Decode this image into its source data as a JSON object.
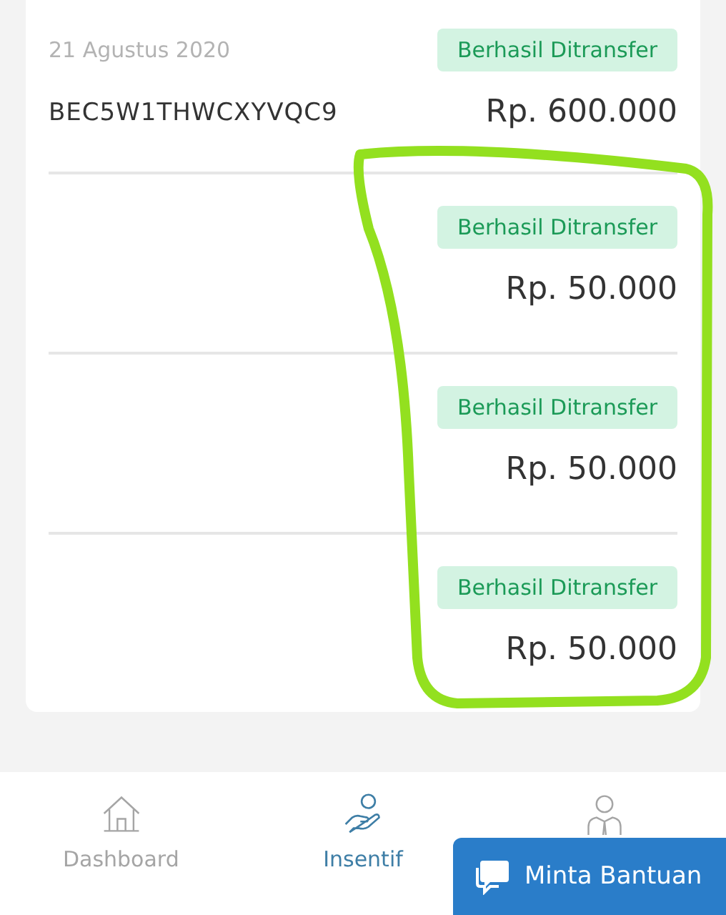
{
  "transactions": [
    {
      "date": "21 Agustus 2020",
      "code": "BEC5W1THWCXYVQC9",
      "status": "Berhasil Ditransfer",
      "amount": "Rp. 600.000"
    },
    {
      "status": "Berhasil Ditransfer",
      "amount": "Rp. 50.000"
    },
    {
      "status": "Berhasil Ditransfer",
      "amount": "Rp. 50.000"
    },
    {
      "status": "Berhasil Ditransfer",
      "amount": "Rp. 50.000"
    }
  ],
  "bottom_nav": [
    {
      "kind": "house",
      "label": "Dashboard",
      "selected": false
    },
    {
      "kind": "hand",
      "label": "Insentif",
      "selected": true
    },
    {
      "kind": "person",
      "selected": false
    }
  ],
  "help_button": {
    "label": "Minta Bantuan"
  }
}
